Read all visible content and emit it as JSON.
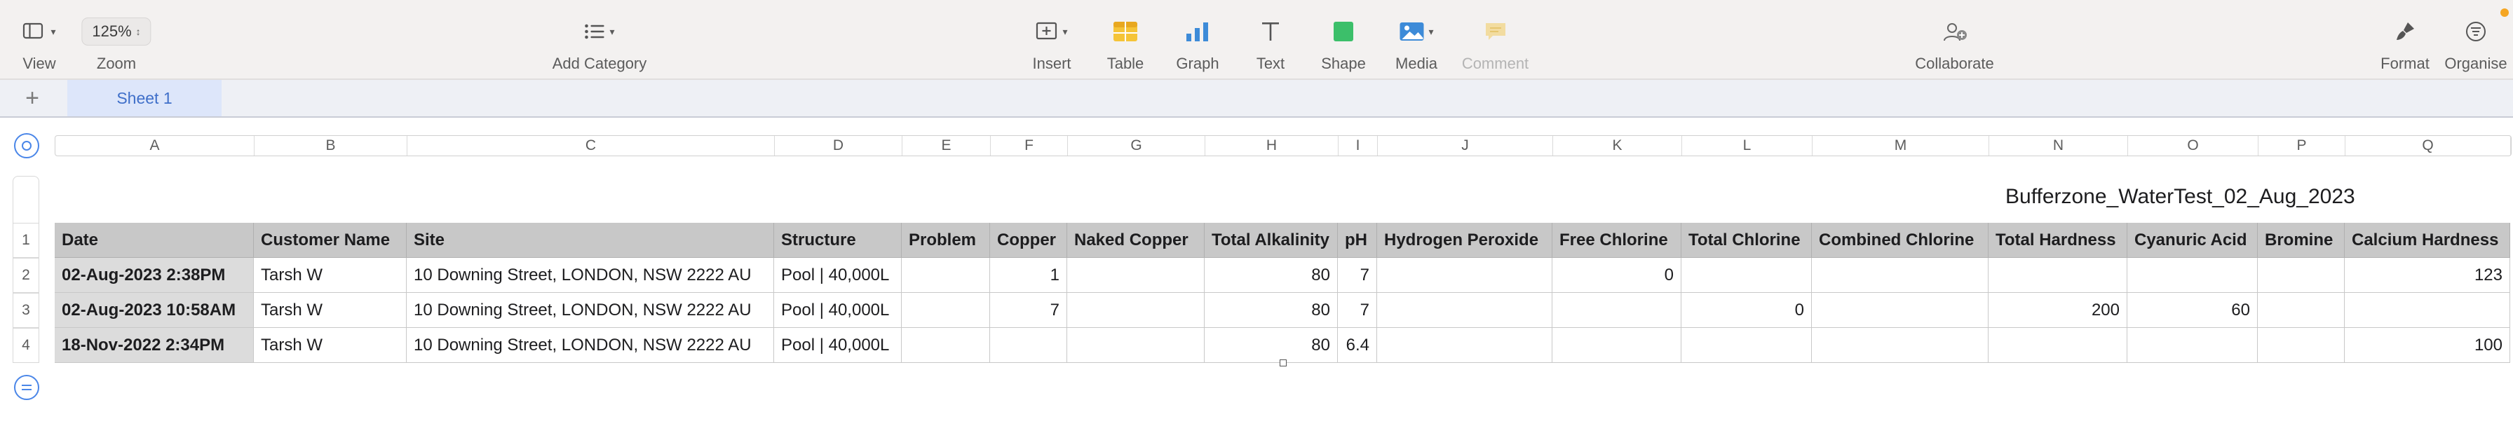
{
  "toolbar": {
    "view": "View",
    "zoom_label": "Zoom",
    "zoom_value": "125%",
    "add_category": "Add Category",
    "insert": "Insert",
    "table": "Table",
    "graph": "Graph",
    "text": "Text",
    "shape": "Shape",
    "media": "Media",
    "comment": "Comment",
    "collaborate": "Collaborate",
    "format": "Format",
    "organise": "Organise"
  },
  "sheet_tabs": [
    "Sheet 1"
  ],
  "columns": [
    "A",
    "B",
    "C",
    "D",
    "E",
    "F",
    "G",
    "H",
    "I",
    "J",
    "K",
    "L",
    "M",
    "N",
    "O",
    "P",
    "Q"
  ],
  "row_numbers": [
    "1",
    "2",
    "3",
    "4"
  ],
  "table_title": "Bufferzone_WaterTest_02_Aug_2023",
  "table": {
    "headers": [
      "Date",
      "Customer Name",
      "Site",
      "Structure",
      "Problem",
      "Copper",
      "Naked Copper",
      "Total Alkalinity",
      "pH",
      "Hydrogen Peroxide",
      "Free Chlorine",
      "Total Chlorine",
      "Combined Chlorine",
      "Total Hardness",
      "Cyanuric Acid",
      "Bromine",
      "Calcium Hardness"
    ],
    "rows": [
      [
        "02-Aug-2023 2:38PM",
        "Tarsh W",
        "10 Downing Street, LONDON, NSW 2222 AU",
        "Pool | 40,000L",
        "",
        "1",
        "",
        "80",
        "7",
        "",
        "0",
        "",
        "",
        "",
        "",
        "",
        "123"
      ],
      [
        "02-Aug-2023 10:58AM",
        "Tarsh W",
        "10 Downing Street, LONDON, NSW 2222 AU",
        "Pool | 40,000L",
        "",
        "7",
        "",
        "80",
        "7",
        "",
        "",
        "0",
        "",
        "200",
        "60",
        "",
        ""
      ],
      [
        "18-Nov-2022 2:34PM",
        "Tarsh W",
        "10 Downing Street, LONDON, NSW 2222 AU",
        "Pool | 40,000L",
        "",
        "",
        "",
        "80",
        "6.4",
        "",
        "",
        "",
        "",
        "",
        "",
        "",
        "100"
      ]
    ]
  },
  "colors": {
    "accent": "#4a86e8",
    "sheet_tab_text": "#3f6fc9",
    "header_fill": "#c8c8c8",
    "notification_dot": "#f5a623"
  },
  "icons": {
    "view": "sidebar-view-icon",
    "add_category": "list-icon",
    "insert": "insert-icon",
    "table": "table-icon",
    "graph": "bar-chart-icon",
    "text": "text-icon",
    "shape": "shape-icon",
    "media": "media-icon",
    "comment": "comment-icon",
    "collaborate": "collaborate-icon",
    "format": "paintbrush-icon",
    "organise": "organise-icon"
  }
}
